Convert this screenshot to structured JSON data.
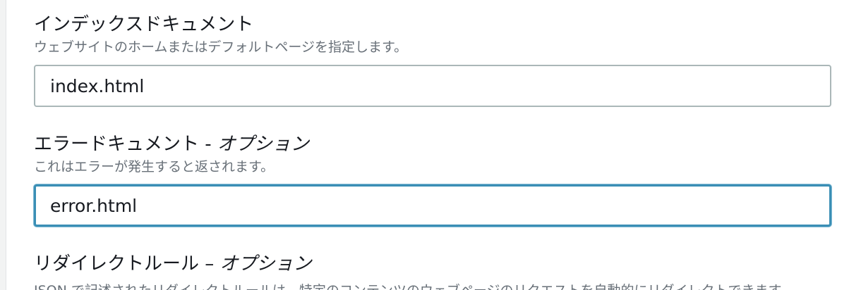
{
  "index_document": {
    "label": "インデックスドキュメント",
    "description": "ウェブサイトのホームまたはデフォルトページを指定します。",
    "value": "index.html"
  },
  "error_document": {
    "label": "エラードキュメント - ",
    "optional": "オプション",
    "description": "これはエラーが発生すると返されます。",
    "value": "error.html"
  },
  "redirect_rules": {
    "label": "リダイレクトルール – ",
    "optional": "オプション",
    "description": "JSON で記述されたリダイレクトルールは、特定のコンテンツのウェブページのリクエストを自動的にリダイレクトできます。"
  },
  "colors": {
    "focus_border": "#3b8fb5",
    "input_border": "#aab7b8",
    "label_text": "#16191f",
    "description_text": "#687078"
  }
}
